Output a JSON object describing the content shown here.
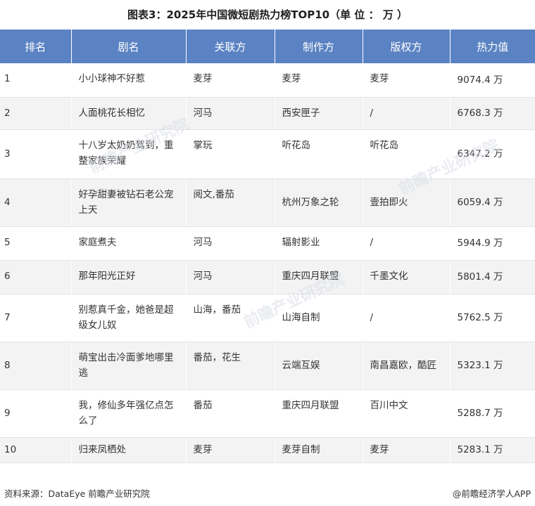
{
  "title": "图表3：2025年中国微短剧热力榜TOP10（单 位 ： 万 ）",
  "table": {
    "headers": [
      "排名",
      "剧名",
      "关联方",
      "制作方",
      "版权方",
      "热力值"
    ],
    "rows": [
      {
        "rank": "1",
        "name": "小小球神不好惹",
        "related": "麦芽",
        "producer": "麦芽",
        "copyright": "麦芽",
        "heat": "9074.4 万"
      },
      {
        "rank": "2",
        "name": "人面桃花长相忆",
        "related": "河马",
        "producer": "西安匣子",
        "copyright": "/",
        "heat": "6768.3 万"
      },
      {
        "rank": "3",
        "name": "十八岁太奶奶驾到，重整家族荣耀",
        "related": "掌玩",
        "producer": "听花岛",
        "copyright": "听花岛",
        "heat": "6347.2 万"
      },
      {
        "rank": "4",
        "name": "好孕甜妻被钻石老公宠上天",
        "related": "阅文,番茄",
        "producer": "杭州万象之轮",
        "copyright": "壹拍即火",
        "heat": "6059.4 万"
      },
      {
        "rank": "5",
        "name": "家庭煮夫",
        "related": "河马",
        "producer": "辐射影业",
        "copyright": "/",
        "heat": "5944.9 万"
      },
      {
        "rank": "6",
        "name": "那年阳光正好",
        "related": "河马",
        "producer": "重庆四月联盟",
        "copyright": "千墨文化",
        "heat": "5801.4 万"
      },
      {
        "rank": "7",
        "name": "别惹真千金，她爸是超级女儿奴",
        "related": "山海，番茄",
        "producer": "山海自制",
        "copyright": "/",
        "heat": "5762.5 万"
      },
      {
        "rank": "8",
        "name": "萌宝出击冷面爹地哪里逃",
        "related": "番茄，花生",
        "producer": "云端互娱",
        "copyright": "南昌嘉欧，酷匠",
        "heat": "5323.1 万"
      },
      {
        "rank": "9",
        "name": "我，修仙多年强亿点怎么了",
        "related": "番茄",
        "producer": "重庆四月联盟",
        "copyright": "百川中文",
        "heat": "5288.7 万"
      },
      {
        "rank": "10",
        "name": "归来凤栖处",
        "related": "麦芽",
        "producer": "麦芽自制",
        "copyright": "麦芽",
        "heat": "5283.1 万"
      }
    ]
  },
  "footer": {
    "source": "资料来源：DataEye  前瞻产业研究院",
    "brand": "@前瞻经济学人APP"
  },
  "watermark": "前瞻产业研究院"
}
